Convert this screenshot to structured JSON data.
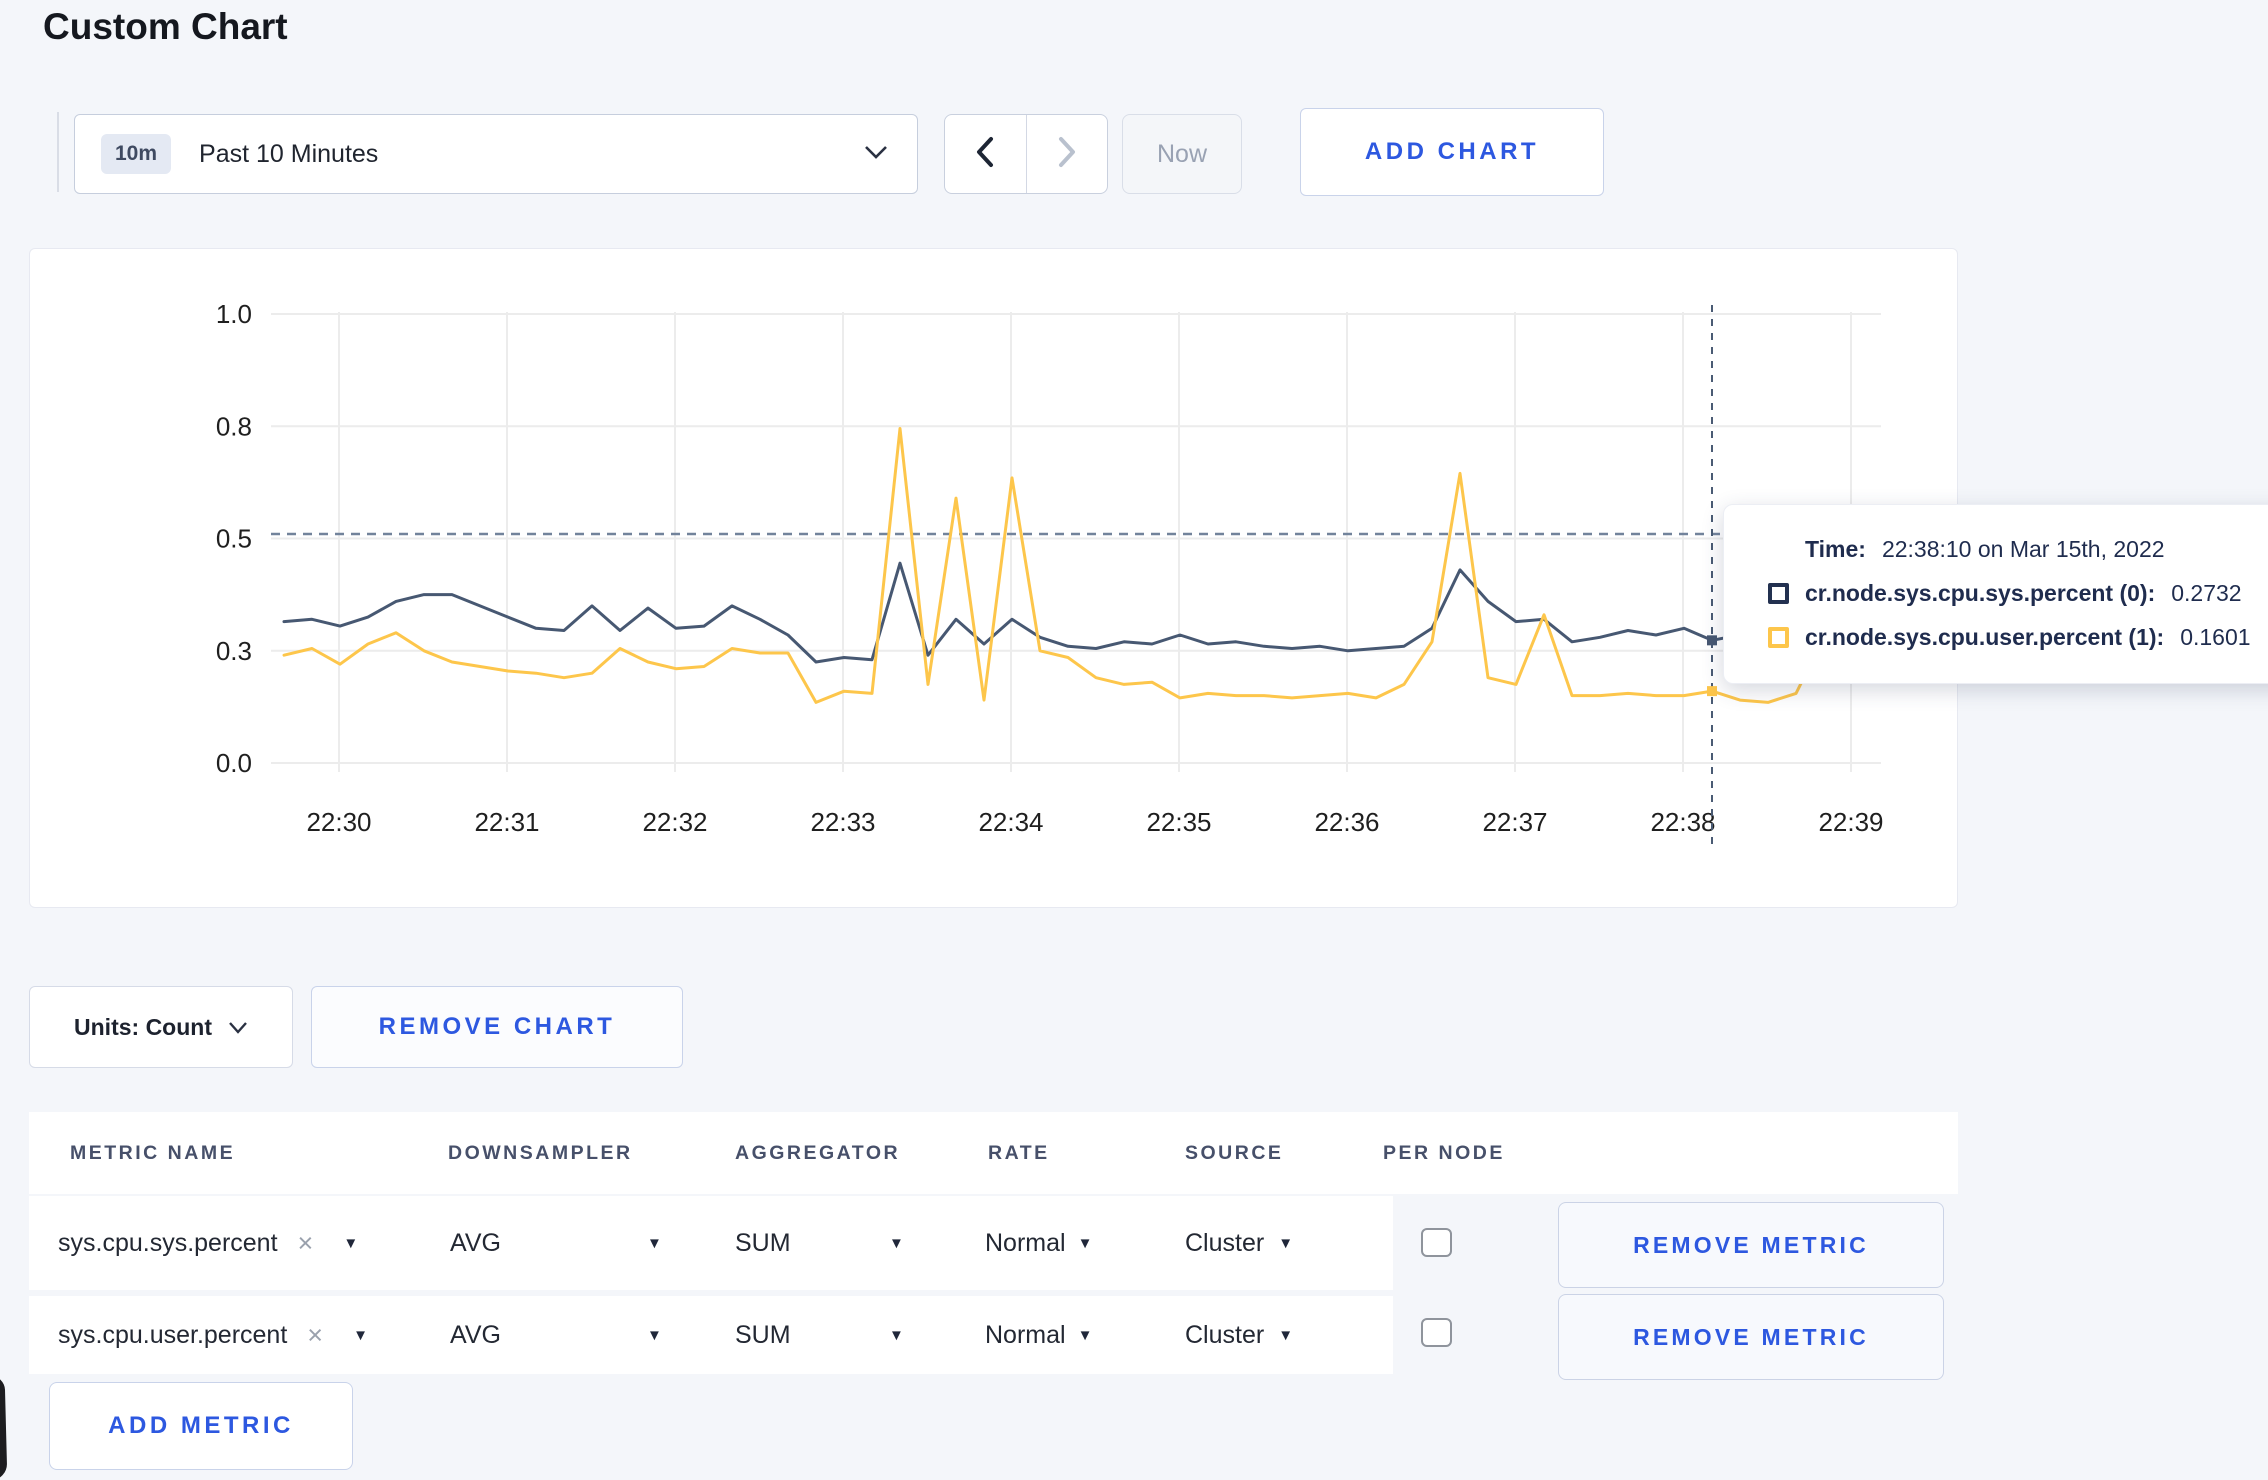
{
  "page": {
    "title": "Custom Chart"
  },
  "colors": {
    "accent_blue": "#2d58e0",
    "series_sys": "#475872",
    "series_user": "#fdc64b",
    "gridline": "#ececec",
    "crosshair": "#4a5b74"
  },
  "toolbar": {
    "time_badge": "10m",
    "time_range": "Past 10 Minutes",
    "now": "Now",
    "add_chart": "ADD CHART"
  },
  "chart_data": {
    "type": "line",
    "title": "",
    "x_start": "22:29:40",
    "x_end": "22:39:10",
    "x_step_seconds": 10,
    "x_ticks": [
      "22:30",
      "22:31",
      "22:32",
      "22:33",
      "22:34",
      "22:35",
      "22:36",
      "22:37",
      "22:38",
      "22:39"
    ],
    "y_domain": [
      0,
      1
    ],
    "y_ticks": [
      {
        "value": 0.0,
        "label": "0.0"
      },
      {
        "value": 0.25,
        "label": "0.3"
      },
      {
        "value": 0.5,
        "label": "0.5"
      },
      {
        "value": 0.75,
        "label": "0.8"
      },
      {
        "value": 1.0,
        "label": "1.0"
      }
    ],
    "grid": true,
    "legend": "none",
    "dashed_guideline_value": 0.51,
    "crosshair": {
      "index": 51,
      "time": "22:38:10"
    },
    "series": [
      {
        "name": "cr.node.sys.cpu.sys.percent",
        "color": "#475872",
        "values": [
          0.315,
          0.32,
          0.305,
          0.325,
          0.36,
          0.375,
          0.375,
          0.35,
          0.325,
          0.3,
          0.295,
          0.35,
          0.295,
          0.345,
          0.3,
          0.305,
          0.35,
          0.32,
          0.285,
          0.225,
          0.235,
          0.23,
          0.445,
          0.24,
          0.32,
          0.265,
          0.32,
          0.28,
          0.26,
          0.255,
          0.27,
          0.265,
          0.285,
          0.265,
          0.27,
          0.26,
          0.255,
          0.26,
          0.25,
          0.255,
          0.26,
          0.3,
          0.43,
          0.36,
          0.315,
          0.32,
          0.27,
          0.28,
          0.295,
          0.285,
          0.3,
          0.2732,
          0.285,
          0.29,
          0.285,
          0.28,
          0.295,
          0.3
        ]
      },
      {
        "name": "cr.node.sys.cpu.user.percent",
        "color": "#fdc64b",
        "values": [
          0.24,
          0.255,
          0.22,
          0.265,
          0.29,
          0.25,
          0.225,
          0.215,
          0.205,
          0.2,
          0.19,
          0.2,
          0.255,
          0.225,
          0.21,
          0.215,
          0.255,
          0.245,
          0.245,
          0.135,
          0.16,
          0.155,
          0.745,
          0.175,
          0.59,
          0.14,
          0.635,
          0.25,
          0.235,
          0.19,
          0.175,
          0.18,
          0.145,
          0.155,
          0.15,
          0.15,
          0.145,
          0.15,
          0.155,
          0.145,
          0.175,
          0.27,
          0.645,
          0.19,
          0.175,
          0.33,
          0.15,
          0.15,
          0.155,
          0.15,
          0.15,
          0.1601,
          0.14,
          0.135,
          0.155,
          0.28,
          0.22,
          0.285
        ]
      }
    ]
  },
  "tooltip": {
    "time_label": "Time:",
    "time_value": "22:38:10 on Mar 15th, 2022",
    "rows": [
      {
        "label": "cr.node.sys.cpu.sys.percent (0):",
        "value": "0.2732",
        "color": "#233150"
      },
      {
        "label": "cr.node.sys.cpu.user.percent (1):",
        "value": "0.1601",
        "color": "#fdc64b"
      }
    ]
  },
  "chart_controls": {
    "units": "Units: Count",
    "remove_chart": "REMOVE CHART"
  },
  "metrics_table": {
    "headers": [
      "METRIC NAME",
      "DOWNSAMPLER",
      "AGGREGATOR",
      "RATE",
      "SOURCE",
      "PER NODE"
    ],
    "remove_metric": "REMOVE METRIC",
    "add_metric": "ADD METRIC",
    "rows": [
      {
        "metric": "sys.cpu.sys.percent",
        "downsampler": "AVG",
        "aggregator": "SUM",
        "rate": "Normal",
        "source": "Cluster",
        "per_node": false
      },
      {
        "metric": "sys.cpu.user.percent",
        "downsampler": "AVG",
        "aggregator": "SUM",
        "rate": "Normal",
        "source": "Cluster",
        "per_node": false
      }
    ]
  }
}
